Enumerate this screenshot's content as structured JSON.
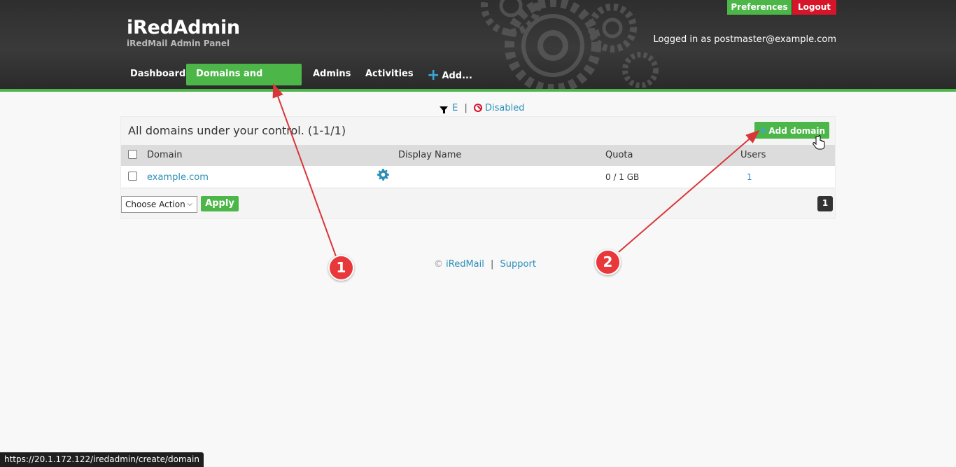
{
  "brand": {
    "title": "iRedAdmin",
    "subtitle": "iRedMail Admin Panel"
  },
  "top_buttons": {
    "preferences": "Preferences",
    "logout": "Logout"
  },
  "logged_in_text": "Logged in as postmaster@example.com",
  "nav": {
    "dashboard": "Dashboard",
    "domains": "Domains and Accounts",
    "admins": "Admins",
    "activities": "Activities",
    "add": "Add..."
  },
  "filter": {
    "letter": "E",
    "separator": "|",
    "disabled": "Disabled"
  },
  "panel": {
    "title": "All domains under your control. (1-1/1)",
    "add_domain": "Add domain",
    "columns": [
      "Domain",
      "Display Name",
      "Quota",
      "Users"
    ],
    "rows": [
      {
        "domain": "example.com",
        "display_name": "",
        "quota": "0 / 1 GB",
        "users": "1"
      }
    ],
    "choose_action": "Choose Action",
    "apply": "Apply",
    "page": "1"
  },
  "footer": {
    "copyright": "©",
    "iredmail": "iRedMail",
    "separator": "|",
    "support": "Support"
  },
  "annotations": {
    "badge1": "1",
    "badge2": "2",
    "color": "#e8383a"
  },
  "status_url": "https://20.1.172.122/iredadmin/create/domain",
  "colors": {
    "accent_green": "#4cb748",
    "logout_red": "#d6142a",
    "link_blue": "#2b8fb8"
  }
}
